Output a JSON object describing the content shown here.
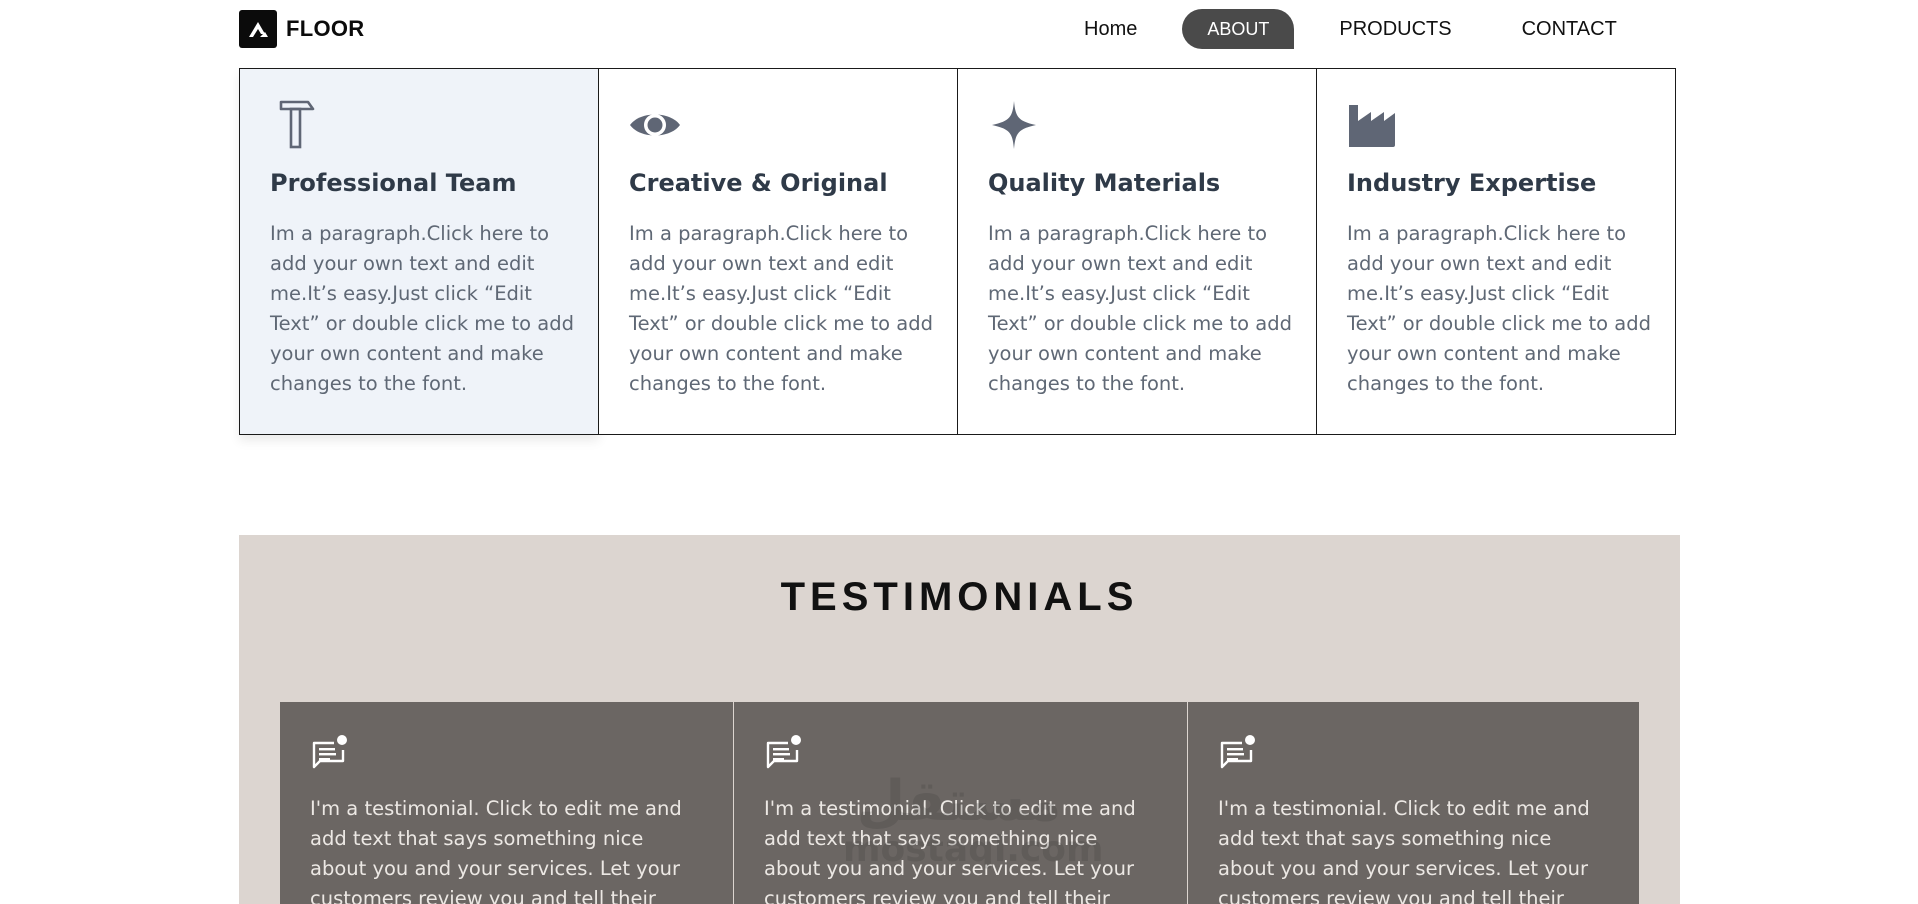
{
  "brand": {
    "name": "FLOOR",
    "logo_icon": "floor-logo-icon"
  },
  "nav": {
    "items": [
      {
        "label": "Home",
        "active": false
      },
      {
        "label": "ABOUT",
        "active": true
      },
      {
        "label": "PRODUCTS",
        "active": false
      },
      {
        "label": "CONTACT",
        "active": false
      }
    ]
  },
  "features": [
    {
      "icon": "hammer-icon",
      "title": "Professional Team",
      "text": "Im a paragraph.Click here to add your own text and edit me.It’s easy.Just click “Edit Text” or double click me to add your own content and make changes to the font."
    },
    {
      "icon": "eye-icon",
      "title": "Creative & Original",
      "text": "Im a paragraph.Click here to add your own text and edit me.It’s easy.Just click “Edit Text” or double click me to add your own content and make changes to the font."
    },
    {
      "icon": "sparkle-icon",
      "title": "Quality Materials",
      "text": "Im a paragraph.Click here to add your own text and edit me.It’s easy.Just click “Edit Text” or double click me to add your own content and make changes to the font."
    },
    {
      "icon": "factory-icon",
      "title": "Industry Expertise",
      "text": "Im a paragraph.Click here to add your own text and edit me.It’s easy.Just click “Edit Text” or double click me to add your own content and make changes to the font."
    }
  ],
  "testimonials": {
    "title": "TESTIMONIALS",
    "items": [
      {
        "icon": "chat-notification-icon",
        "text": "I'm a testimonial. Click to edit me and add text that says something nice about you and your services. Let your customers review you and tell their"
      },
      {
        "icon": "chat-notification-icon",
        "text": "I'm a testimonial. Click to edit me and add text that says something nice about you and your services. Let your customers review you and tell their"
      },
      {
        "icon": "chat-notification-icon",
        "text": "I'm a testimonial. Click to edit me and add text that says something nice about you and your services. Let your customers review you and tell their"
      }
    ]
  },
  "watermark": {
    "arabic": "مستقل",
    "latin": "mostaql.com"
  },
  "colors": {
    "nav_active_bg": "#4a4a4a",
    "feature_highlight_bg": "#eff3f9",
    "feature_title": "#2f3a48",
    "feature_text": "#5f6875",
    "icon_gray": "#5f6675",
    "testimonials_bg": "#dcd5d0",
    "testimonial_card_bg": "#6b6663",
    "testimonial_text": "#ece8e4"
  }
}
